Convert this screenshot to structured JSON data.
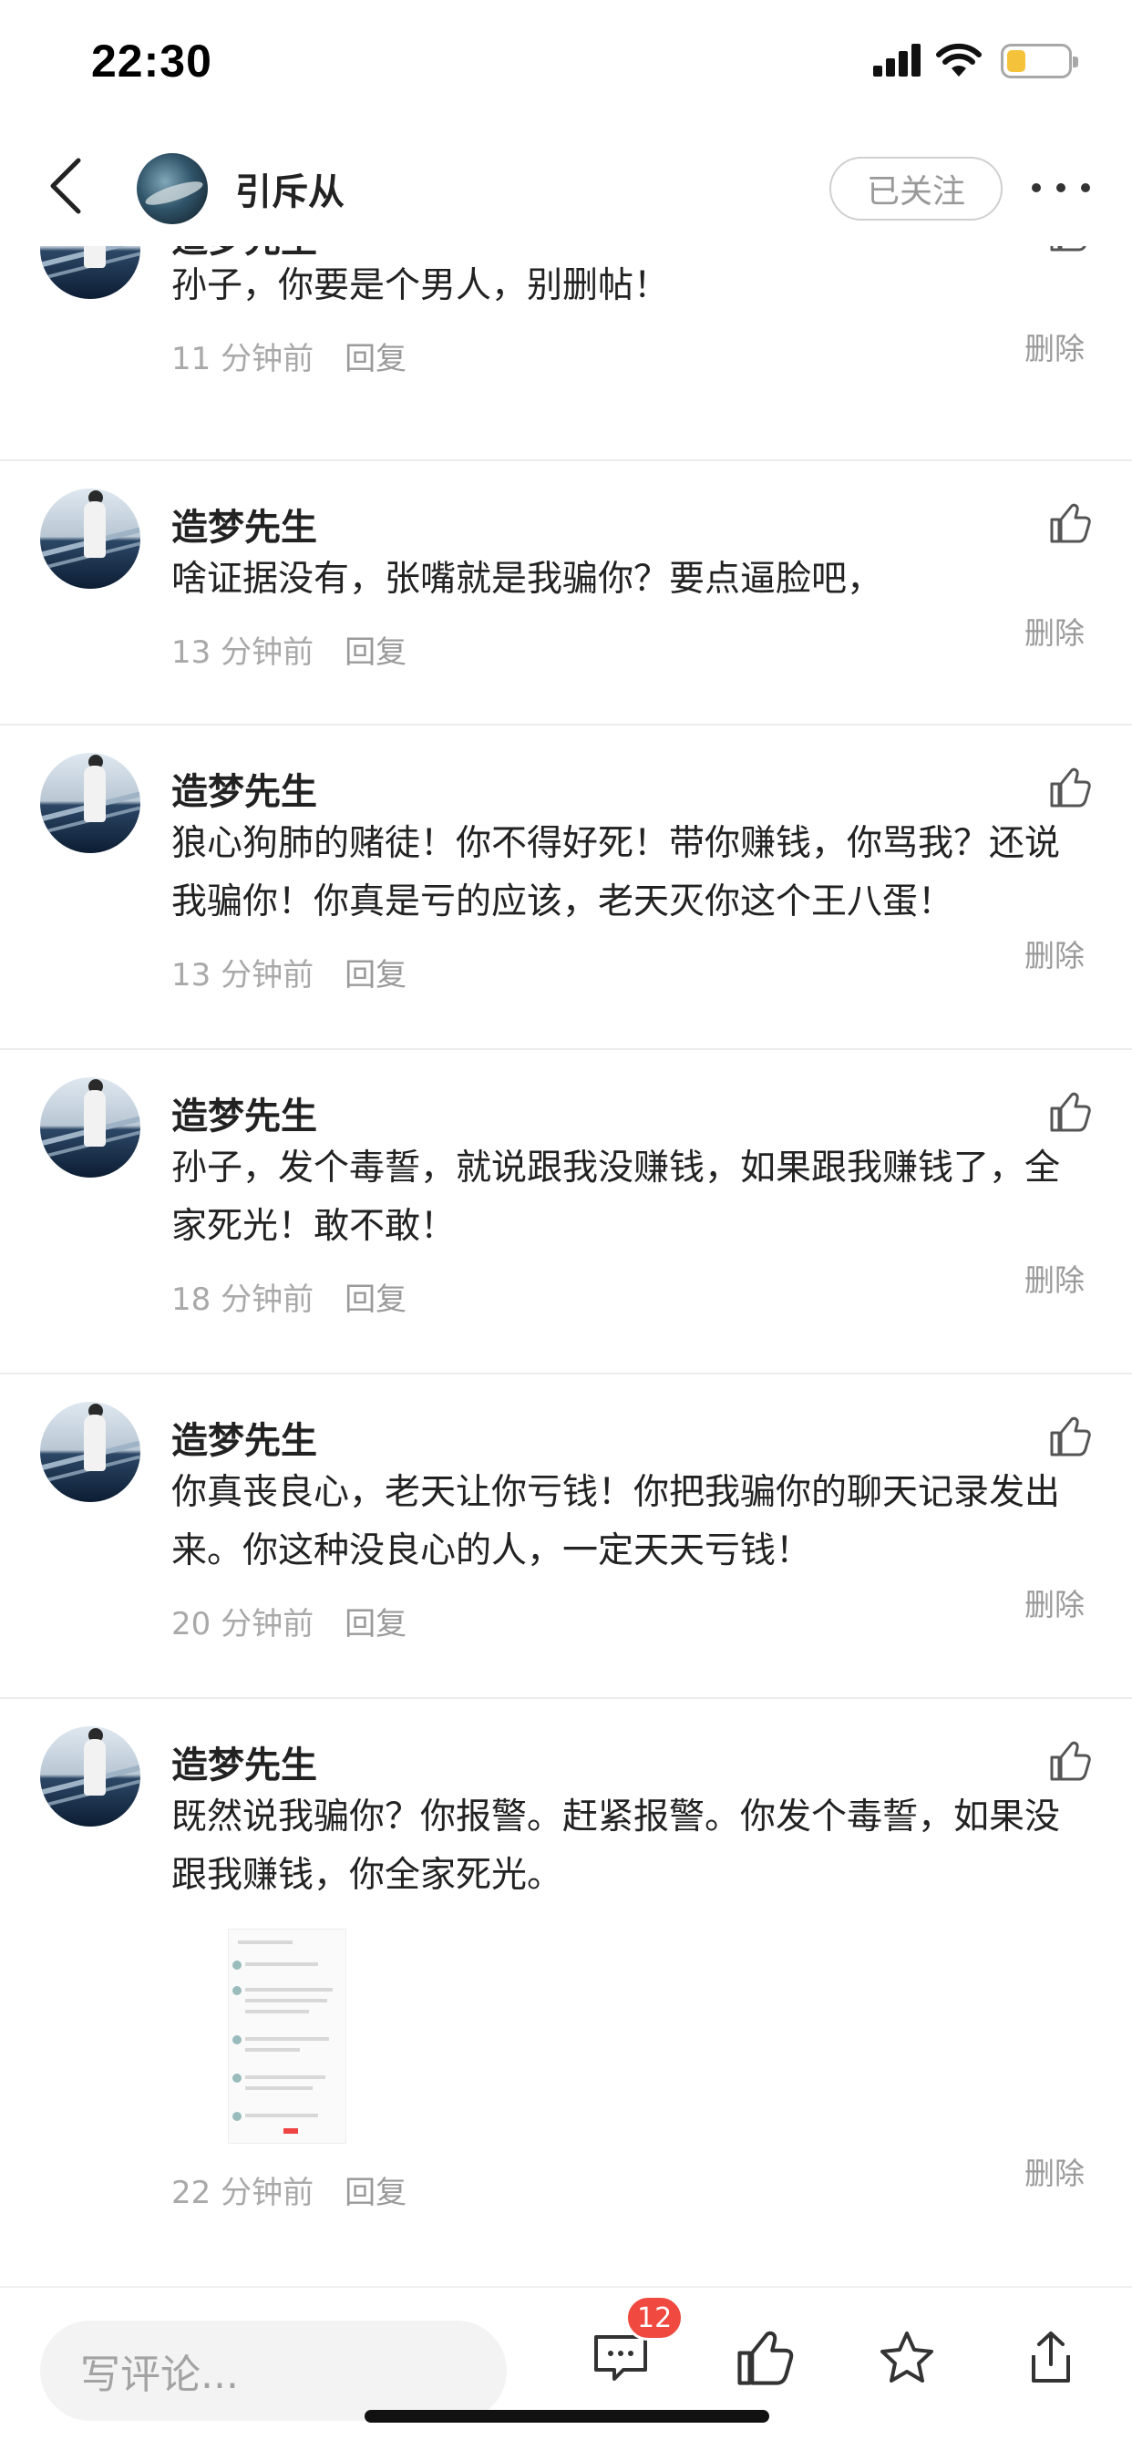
{
  "status_bar": {
    "time": "22:30"
  },
  "nav": {
    "title": "引斥从",
    "follow_label": "已关注"
  },
  "comments": [
    {
      "username": "造梦先生",
      "text": "孙子，你要是个男人，别删帖！",
      "time": "11 分钟前",
      "reply": "回复",
      "delete": "删除"
    },
    {
      "username": "造梦先生",
      "text": "啥证据没有，张嘴就是我骗你？要点逼脸吧，",
      "time": "13 分钟前",
      "reply": "回复",
      "delete": "删除"
    },
    {
      "username": "造梦先生",
      "text": "狼心狗肺的赌徒！你不得好死！带你赚钱，你骂我？还说我骗你！你真是亏的应该，老天灭你这个王八蛋！",
      "time": "13 分钟前",
      "reply": "回复",
      "delete": "删除"
    },
    {
      "username": "造梦先生",
      "text": "孙子，发个毒誓，就说跟我没赚钱，如果跟我赚钱了，全家死光！敢不敢！",
      "time": "18 分钟前",
      "reply": "回复",
      "delete": "删除"
    },
    {
      "username": "造梦先生",
      "text": "你真丧良心，老天让你亏钱！你把我骗你的聊天记录发出来。你这种没良心的人，一定天天亏钱！",
      "time": "20 分钟前",
      "reply": "回复",
      "delete": "删除"
    },
    {
      "username": "造梦先生",
      "text": "既然说我骗你？你报警。赶紧报警。你发个毒誓，如果没跟我赚钱，你全家死光。",
      "time": "22 分钟前",
      "reply": "回复",
      "delete": "删除"
    }
  ],
  "bottom_bar": {
    "input_placeholder": "写评论...",
    "comment_count_badge": "12"
  },
  "icons": [
    "back-icon",
    "avatar",
    "more-icon",
    "thumbs-up-icon",
    "comment-icon",
    "star-icon",
    "share-icon"
  ],
  "colors": {
    "badge": "#f0493f",
    "battery": "#f5c33b",
    "secondary_text": "#a9a9a9"
  }
}
